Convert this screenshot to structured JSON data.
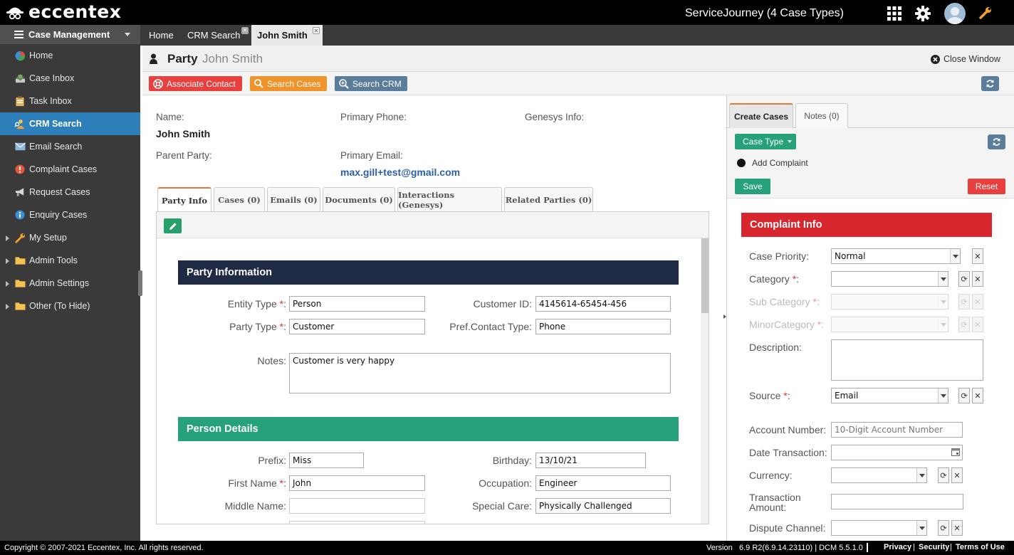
{
  "brand": {
    "name": "eccentex",
    "app_title": "ServiceJourney (4 Case Types)"
  },
  "topbar_icons": [
    "grid-icon",
    "gear-icon",
    "user-avatar",
    "wrench-icon"
  ],
  "sidebar": {
    "header": "Case Management",
    "items": [
      {
        "label": "Home",
        "icon": "home-pie-icon"
      },
      {
        "label": "Case Inbox",
        "icon": "inbox-tray-icon"
      },
      {
        "label": "Task Inbox",
        "icon": "clipboard-icon"
      },
      {
        "label": "CRM Search",
        "icon": "people-search-icon",
        "active": true
      },
      {
        "label": "Email Search",
        "icon": "envelope-icon"
      },
      {
        "label": "Complaint Cases",
        "icon": "alert-icon"
      },
      {
        "label": "Request Cases",
        "icon": "megaphone-icon"
      },
      {
        "label": "Enquiry Cases",
        "icon": "info-icon"
      },
      {
        "label": "My Setup",
        "icon": "wrench-icon",
        "expandable": true
      },
      {
        "label": "Admin Tools",
        "icon": "folder-icon",
        "expandable": true
      },
      {
        "label": "Admin Settings",
        "icon": "folder-icon",
        "expandable": true
      },
      {
        "label": "Other (To Hide)",
        "icon": "folder-icon",
        "expandable": true
      }
    ]
  },
  "tabs": [
    {
      "label": "Home"
    },
    {
      "label": "CRM Search",
      "closable": true
    },
    {
      "label": "John Smith",
      "closable": true,
      "active": true
    }
  ],
  "page_header": {
    "title": "Party",
    "name": "John Smith",
    "close_label": "Close Window"
  },
  "toolbar": {
    "associate_contact": "Associate Contact",
    "search_cases": "Search Cases",
    "search_crm": "Search CRM"
  },
  "colors": {
    "associate": "#e8403e",
    "search_cases": "#f0932b",
    "search_crm": "#5c7d9a",
    "party_info_header": "#1f2a44",
    "person_details_header": "#26a17b",
    "complaint_header": "#d8262f",
    "active_nav": "#2c7fb8"
  },
  "summary": {
    "name_label": "Name:",
    "name_value": "John Smith",
    "phone_label": "Primary Phone:",
    "genesys_label": "Genesys Info:",
    "parent_label": "Parent Party:",
    "email_label": "Primary Email:",
    "email_value": "max.gill+test@gmail.com"
  },
  "content_tabs": [
    "Party Info",
    "Cases (0)",
    "Emails (0)",
    "Documents (0)",
    "Interactions (Genesys)",
    "Related Parties (0)"
  ],
  "party_information": {
    "title": "Party Information",
    "entity_type_label": "Entity Type",
    "entity_type": "Person",
    "customer_id_label": "Customer ID:",
    "customer_id": "4145614-65454-456",
    "party_type_label": "Party Type",
    "party_type": "Customer",
    "pref_contact_label": "Pref.Contact Type:",
    "pref_contact": "Phone",
    "notes_label": "Notes:",
    "notes": "Customer is very happy"
  },
  "person_details": {
    "title": "Person Details",
    "prefix_label": "Prefix:",
    "prefix": "Miss",
    "birthday_label": "Birthday:",
    "birthday": "13/10/21",
    "first_name_label": "First Name",
    "first_name": "John",
    "occupation_label": "Occupation:",
    "occupation": "Engineer",
    "middle_name_label": "Middle Name:",
    "middle_name": "",
    "special_care_label": "Special Care:",
    "special_care": "Physically Challenged"
  },
  "side_panel": {
    "tabs": [
      "Create Cases",
      "Notes (0)"
    ],
    "case_type_button": "Case Type",
    "add_complaint": "Add Complaint",
    "save": "Save",
    "reset": "Reset",
    "complaint_info": "Complaint Info",
    "case_priority_label": "Case Priority:",
    "case_priority": "Normal",
    "category_label": "Category",
    "sub_category_label": "Sub Category",
    "minor_category_label": "MinorCategory",
    "description_label": "Description:",
    "source_label": "Source",
    "source": "Email",
    "account_number_label": "Account Number:",
    "account_number_placeholder": "10-Digit Account Number",
    "date_transaction_label": "Date Transaction:",
    "currency_label": "Currency:",
    "transaction_amount_label": "Transaction Amount:",
    "dispute_channel_label": "Dispute Channel:"
  },
  "footer": {
    "copyright": "Copyright © 2007-2021 Eccentex, Inc. All rights reserved.",
    "version_label": "Version",
    "version": "6.9 R2(6.9.14.23110) | DCM 5.5.1.0",
    "links": [
      "Privacy",
      "Security",
      "Terms of Use"
    ]
  }
}
